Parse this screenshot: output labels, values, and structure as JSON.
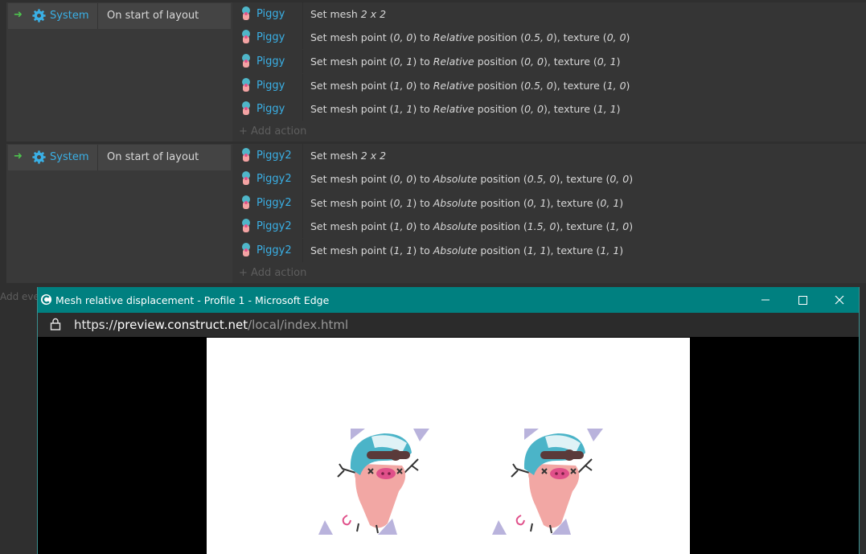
{
  "events": [
    {
      "condition": {
        "object": "System",
        "text": "On start of layout"
      },
      "actions": [
        {
          "object": "Piggy",
          "parts": [
            {
              "t": "Set mesh "
            },
            {
              "t": "2 x 2",
              "i": true
            }
          ]
        },
        {
          "object": "Piggy",
          "parts": [
            {
              "t": "Set mesh point ("
            },
            {
              "t": "0, 0",
              "i": true
            },
            {
              "t": ") to "
            },
            {
              "t": "Relative",
              "i": true
            },
            {
              "t": " position ("
            },
            {
              "t": "0.5, 0",
              "i": true
            },
            {
              "t": "), texture ("
            },
            {
              "t": "0, 0",
              "i": true
            },
            {
              "t": ")"
            }
          ]
        },
        {
          "object": "Piggy",
          "parts": [
            {
              "t": "Set mesh point ("
            },
            {
              "t": "0, 1",
              "i": true
            },
            {
              "t": ") to "
            },
            {
              "t": "Relative",
              "i": true
            },
            {
              "t": " position ("
            },
            {
              "t": "0, 0",
              "i": true
            },
            {
              "t": "), texture ("
            },
            {
              "t": "0, 1",
              "i": true
            },
            {
              "t": ")"
            }
          ]
        },
        {
          "object": "Piggy",
          "parts": [
            {
              "t": "Set mesh point ("
            },
            {
              "t": "1, 0",
              "i": true
            },
            {
              "t": ") to "
            },
            {
              "t": "Relative",
              "i": true
            },
            {
              "t": " position ("
            },
            {
              "t": "0.5, 0",
              "i": true
            },
            {
              "t": "), texture ("
            },
            {
              "t": "1, 0",
              "i": true
            },
            {
              "t": ")"
            }
          ]
        },
        {
          "object": "Piggy",
          "parts": [
            {
              "t": "Set mesh point ("
            },
            {
              "t": "1, 1",
              "i": true
            },
            {
              "t": ") to "
            },
            {
              "t": "Relative",
              "i": true
            },
            {
              "t": " position ("
            },
            {
              "t": "0, 0",
              "i": true
            },
            {
              "t": "), texture ("
            },
            {
              "t": "1, 1",
              "i": true
            },
            {
              "t": ")"
            }
          ]
        }
      ],
      "add_action": "Add action"
    },
    {
      "condition": {
        "object": "System",
        "text": "On start of layout"
      },
      "actions": [
        {
          "object": "Piggy2",
          "parts": [
            {
              "t": "Set mesh "
            },
            {
              "t": "2 x 2",
              "i": true
            }
          ]
        },
        {
          "object": "Piggy2",
          "parts": [
            {
              "t": "Set mesh point ("
            },
            {
              "t": "0, 0",
              "i": true
            },
            {
              "t": ") to "
            },
            {
              "t": "Absolute",
              "i": true
            },
            {
              "t": " position ("
            },
            {
              "t": "0.5, 0",
              "i": true
            },
            {
              "t": "), texture ("
            },
            {
              "t": "0, 0",
              "i": true
            },
            {
              "t": ")"
            }
          ]
        },
        {
          "object": "Piggy2",
          "parts": [
            {
              "t": "Set mesh point ("
            },
            {
              "t": "0, 1",
              "i": true
            },
            {
              "t": ") to "
            },
            {
              "t": "Absolute",
              "i": true
            },
            {
              "t": " position ("
            },
            {
              "t": "0, 1",
              "i": true
            },
            {
              "t": "), texture ("
            },
            {
              "t": "0, 1",
              "i": true
            },
            {
              "t": ")"
            }
          ]
        },
        {
          "object": "Piggy2",
          "parts": [
            {
              "t": "Set mesh point ("
            },
            {
              "t": "1, 0",
              "i": true
            },
            {
              "t": ") to "
            },
            {
              "t": "Absolute",
              "i": true
            },
            {
              "t": " position ("
            },
            {
              "t": "1.5, 0",
              "i": true
            },
            {
              "t": "), texture ("
            },
            {
              "t": "1, 0",
              "i": true
            },
            {
              "t": ")"
            }
          ]
        },
        {
          "object": "Piggy2",
          "parts": [
            {
              "t": "Set mesh point ("
            },
            {
              "t": "1, 1",
              "i": true
            },
            {
              "t": ") to "
            },
            {
              "t": "Absolute",
              "i": true
            },
            {
              "t": " position ("
            },
            {
              "t": "1, 1",
              "i": true
            },
            {
              "t": "), texture ("
            },
            {
              "t": "1, 1",
              "i": true
            },
            {
              "t": ")"
            }
          ]
        }
      ],
      "add_action": "Add action"
    }
  ],
  "add_event": "Add event",
  "browser": {
    "title": "Mesh relative displacement - Profile 1 - Microsoft Edge",
    "url_scheme": "https://",
    "url_host": "preview.construct.net",
    "url_path": "/local/index.html",
    "minimize_icon": "minimize-icon",
    "maximize_icon": "maximize-icon",
    "close_icon": "close-icon"
  },
  "colors": {
    "titlebar": "#008080",
    "object_link": "#3ab0e6",
    "trigger_arrow": "#4ec24e"
  }
}
